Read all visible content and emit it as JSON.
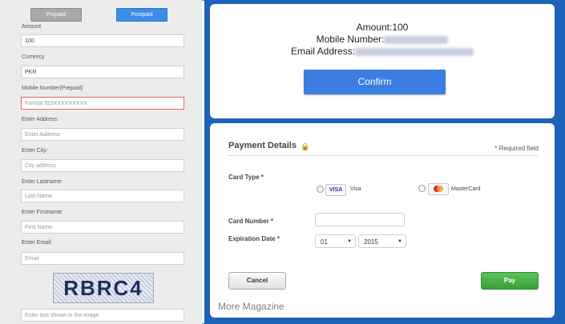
{
  "tabs": {
    "prepaid": "Prepaid",
    "postpaid": "Postpaid"
  },
  "form": {
    "amount_label": "Amount",
    "amount_value": "100",
    "currency_label": "Currency",
    "currency_value": "PKR",
    "mobile_label": "Mobile Number(Prepaid)",
    "mobile_placeholder": "Format 923XXXXXXXXX",
    "address_label": "Enter Address:",
    "address_placeholder": "Enter Address",
    "city_label": "Enter City:",
    "city_placeholder": "City address",
    "lastname_label": "Enter Lastname:",
    "lastname_placeholder": "Last Name",
    "firstname_label": "Enter Firstname:",
    "firstname_placeholder": "First Name",
    "email_label": "Enter Email:",
    "email_placeholder": "Email",
    "captcha_text": "RBRC4",
    "captcha_placeholder": "Enter text shown in the image"
  },
  "summary": {
    "amount": "Amount:100",
    "mobile_label": "Mobile Number:",
    "email_label": "Email Address:",
    "confirm": "Confirm"
  },
  "payment": {
    "title": "Payment Details",
    "required_note": "* Required field",
    "card_type_label": "Card Type *",
    "visa_badge": "VISA",
    "visa_label": "Visa",
    "mastercard_label": "MasterCard",
    "card_number_label": "Card Number *",
    "expiration_label": "Expiration Date *",
    "month_value": "01",
    "year_value": "2015",
    "cancel": "Cancel",
    "pay": "Pay"
  },
  "watermark": "More Magazine"
}
